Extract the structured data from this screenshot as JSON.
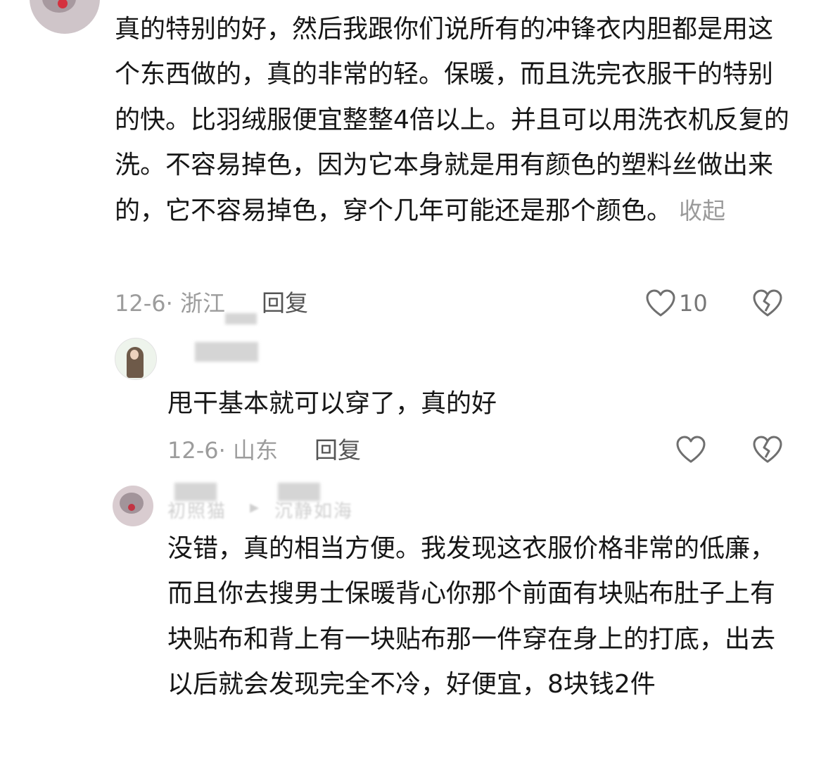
{
  "comment1": {
    "paragraph": "真的特别的好，然后我跟你们说所有的冲锋衣内胆都是用这个东西做的，真的非常的轻。保暖，而且洗完衣服干的特别的快。比羽绒服便宜整整4倍以上。并且可以用洗衣机反复的洗。不容易掉色，因为它本身就是用有颜色的塑料丝做出来的，它不容易掉色，穿个几年可能还是那个颜色。",
    "collapse_label": "收起",
    "date_location": "12-6· 浙江",
    "reply_label": "回复",
    "like_count": "10",
    "like_icon": "heart-outline-icon",
    "dislike_icon": "broken-heart-icon"
  },
  "comment2": {
    "username_hint": "",
    "text": "甩干基本就可以穿了，真的好",
    "date_location": "12-6· 山东",
    "reply_label": "回复"
  },
  "comment3": {
    "username_hint": "初照猫",
    "reply_arrow": "▸",
    "reply_target": "沉静如海",
    "paragraph": "没错，真的相当方便。我发现这衣服价格非常的低廉，而且你去搜男士保暖背心你那个前面有块贴布肚子上有块贴布和背上有一块贴布那一件穿在身上的打底，出去以后就会发现完全不冷，好便宜，8块钱2件"
  },
  "colors": {
    "text": "#161616",
    "meta": "#9c9c9c",
    "icon": "#6f6f6f"
  }
}
